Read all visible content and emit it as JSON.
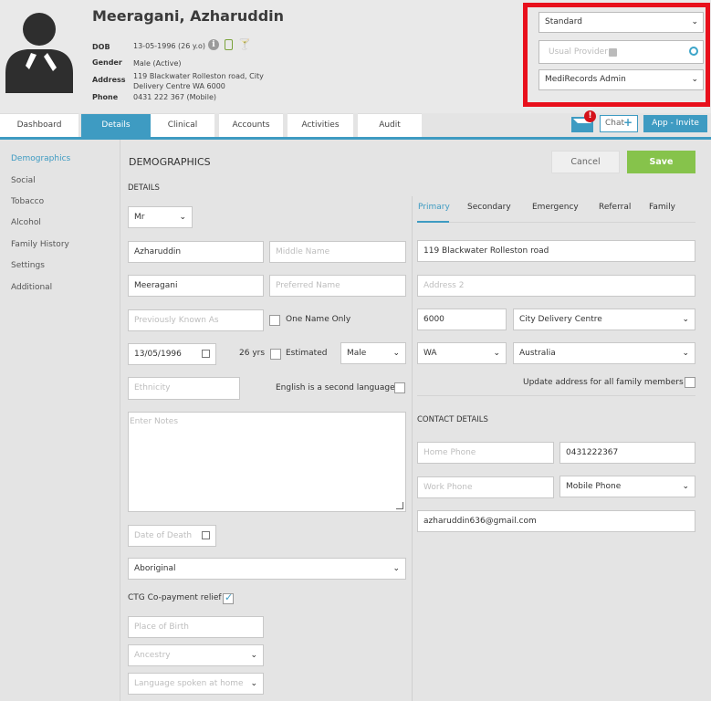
{
  "patient": {
    "name": "Meeragani, Azharuddin",
    "dob_label": "DOB",
    "dob_value": "13-05-1996 (26 y.o)",
    "gender_label": "Gender",
    "gender_value": "Male (Active)",
    "address_label": "Address",
    "address_line1": "119 Blackwater Rolleston road, City",
    "address_line2": "Delivery Centre WA 6000",
    "phone_label": "Phone",
    "phone_value": "0431 222 367 (Mobile)"
  },
  "header_controls": {
    "view_select": "Standard",
    "usual_provider_placeholder": "Usual Provider",
    "user_select": "MediRecords Admin",
    "alert_badge": "!",
    "chat_label": "Chat",
    "chat_plus": "+",
    "app_invite_label": "App - Invite"
  },
  "tabs": [
    "Dashboard",
    "Details",
    "Clinical",
    "Accounts",
    "Activities",
    "Audit"
  ],
  "active_tab": "Details",
  "sidenav": [
    "Demographics",
    "Social",
    "Tobacco",
    "Alcohol",
    "Family History",
    "Settings",
    "Additional"
  ],
  "form": {
    "title": "DEMOGRAPHICS",
    "section": "DETAILS",
    "cancel": "Cancel",
    "save": "Save",
    "title_select": "Mr",
    "first_name": "Azharuddin",
    "middle_name_ph": "Middle Name",
    "last_name": "Meeragani",
    "preferred_name_ph": "Preferred Name",
    "prev_known_ph": "Previously Known As",
    "one_name_only": "One Name Only",
    "dob": "13/05/1996",
    "age": "26 yrs",
    "estimated": "Estimated",
    "gender": "Male",
    "ethnicity_ph": "Ethnicity",
    "english_second": "English is a second language",
    "notes_ph": "Enter Notes",
    "date_of_death_ph": "Date of Death",
    "indigenous": "Aboriginal",
    "ctg_label": "CTG Co-payment relief",
    "place_of_birth_ph": "Place of Birth",
    "ancestry_ph": "Ancestry",
    "language_ph": "Language spoken at home"
  },
  "address": {
    "tabs": [
      "Primary",
      "Secondary",
      "Emergency",
      "Referral",
      "Family"
    ],
    "line1": "119 Blackwater Rolleston road",
    "line2_ph": "Address 2",
    "postcode": "6000",
    "suburb": "City Delivery Centre",
    "state": "WA",
    "country": "Australia",
    "update_family": "Update address for all family members"
  },
  "contact": {
    "title": "CONTACT DETAILS",
    "home_phone_ph": "Home Phone",
    "mobile": "0431222367",
    "work_phone_ph": "Work Phone",
    "phone_type": "Mobile Phone",
    "email": "azharuddin636@gmail.com"
  },
  "colors": {
    "accent": "#3e9bc2",
    "save": "#86c34b",
    "highlight": "#e8101c",
    "badge": "#d4121a"
  }
}
